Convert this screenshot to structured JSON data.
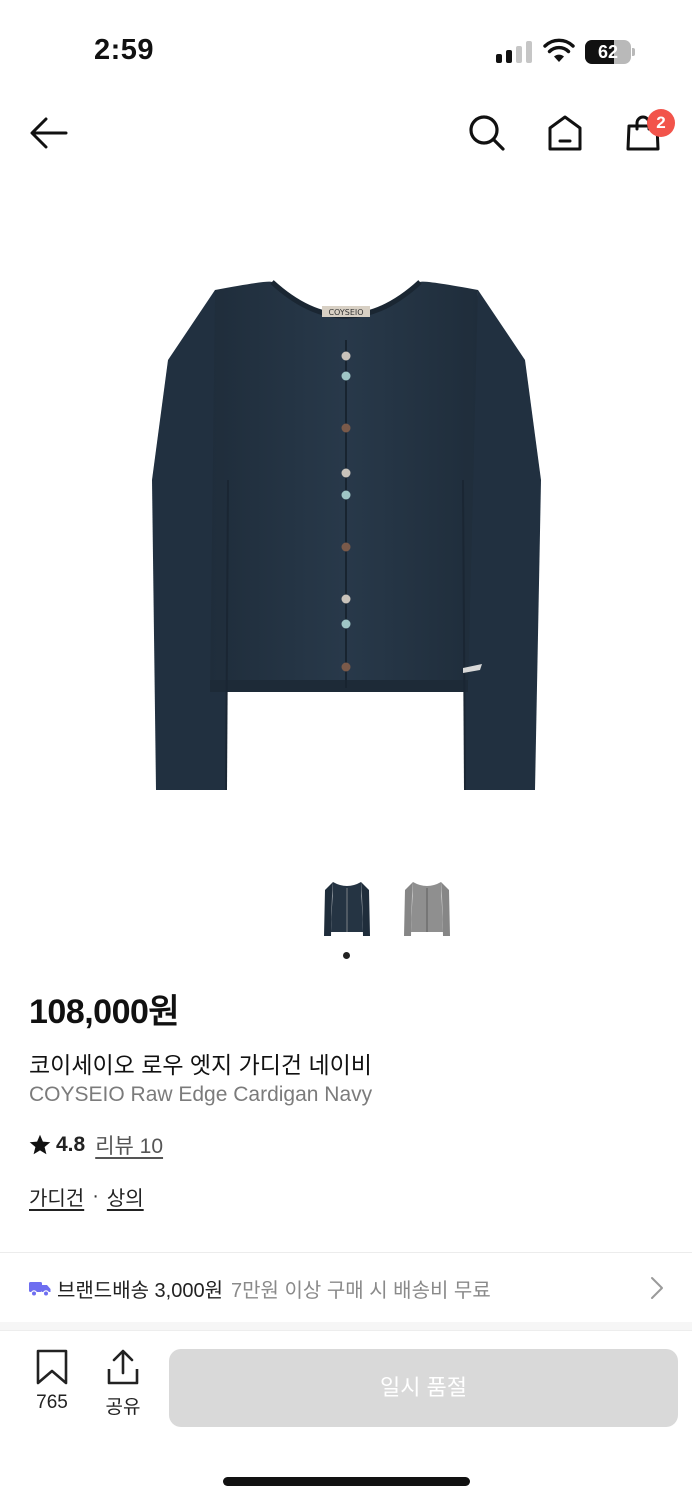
{
  "status_bar": {
    "time": "2:59",
    "battery_level": "62"
  },
  "header": {
    "back_icon": "arrow-left-icon",
    "search_icon": "search-icon",
    "home_icon": "home-icon",
    "cart_icon": "shopping-bag-icon",
    "cart_count": "2"
  },
  "gallery": {
    "image_count": 2,
    "active_index": 0,
    "thumbnails": [
      "navy",
      "gray"
    ]
  },
  "product": {
    "price": "108,000원",
    "name_ko": "코이세이오 로우 엣지 가디건 네이비",
    "name_en": "COYSEIO Raw Edge Cardigan Navy",
    "rating": "4.8",
    "review_label": "리뷰 10",
    "categories": [
      "가디건",
      "상의"
    ],
    "category_separator": "·",
    "label_text": "COYSEIO"
  },
  "shipping": {
    "icon": "truck-icon",
    "label": "브랜드배송 3,000원",
    "note": "7만원 이상 구매 시 배송비 무료"
  },
  "bottom_bar": {
    "bookmark_icon": "bookmark-icon",
    "bookmark_count": "765",
    "share_icon": "share-icon",
    "share_label": "공유",
    "soldout_label": "일시 품절"
  },
  "colors": {
    "badge": "#f2544b",
    "truck": "#6e6ef0",
    "garment_navy": "#253443",
    "garment_gray": "#8f8f8f",
    "disabled_button": "#d9d9d9"
  }
}
